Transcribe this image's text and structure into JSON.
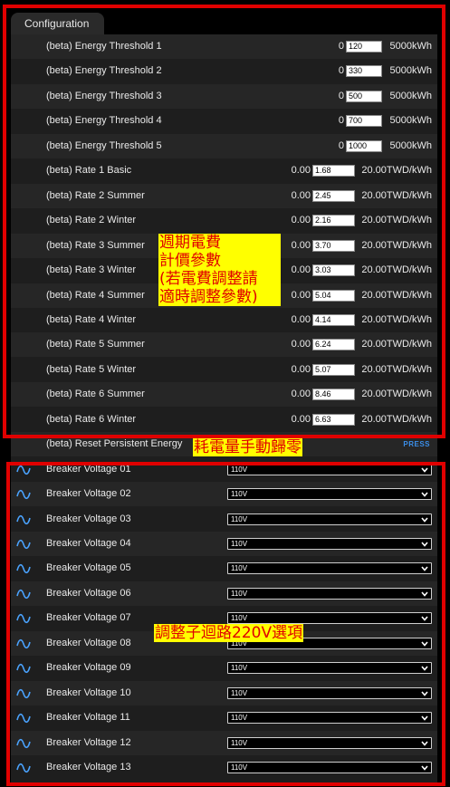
{
  "tab": {
    "label": "Configuration"
  },
  "thresholds": [
    {
      "label": "(beta) Energy Threshold 1",
      "min": "0",
      "value": "120",
      "max": "5000kWh"
    },
    {
      "label": "(beta) Energy Threshold 2",
      "min": "0",
      "value": "330",
      "max": "5000kWh"
    },
    {
      "label": "(beta) Energy Threshold 3",
      "min": "0",
      "value": "500",
      "max": "5000kWh"
    },
    {
      "label": "(beta) Energy Threshold 4",
      "min": "0",
      "value": "700",
      "max": "5000kWh"
    },
    {
      "label": "(beta) Energy Threshold 5",
      "min": "0",
      "value": "1000",
      "max": "5000kWh"
    }
  ],
  "rates": [
    {
      "label": "(beta) Rate 1 Basic",
      "min": "0.00",
      "value": "1.68",
      "max": "20.00TWD/kWh"
    },
    {
      "label": "(beta) Rate 2 Summer",
      "min": "0.00",
      "value": "2.45",
      "max": "20.00TWD/kWh"
    },
    {
      "label": "(beta) Rate 2 Winter",
      "min": "0.00",
      "value": "2.16",
      "max": "20.00TWD/kWh"
    },
    {
      "label": "(beta) Rate 3 Summer",
      "min": "0.00",
      "value": "3.70",
      "max": "20.00TWD/kWh"
    },
    {
      "label": "(beta) Rate 3 Winter",
      "min": "0.00",
      "value": "3.03",
      "max": "20.00TWD/kWh"
    },
    {
      "label": "(beta) Rate 4 Summer",
      "min": "0.00",
      "value": "5.04",
      "max": "20.00TWD/kWh"
    },
    {
      "label": "(beta) Rate 4 Winter",
      "min": "0.00",
      "value": "4.14",
      "max": "20.00TWD/kWh"
    },
    {
      "label": "(beta) Rate 5 Summer",
      "min": "0.00",
      "value": "6.24",
      "max": "20.00TWD/kWh"
    },
    {
      "label": "(beta) Rate 5 Winter",
      "min": "0.00",
      "value": "5.07",
      "max": "20.00TWD/kWh"
    },
    {
      "label": "(beta) Rate 6 Summer",
      "min": "0.00",
      "value": "8.46",
      "max": "20.00TWD/kWh"
    },
    {
      "label": "(beta) Rate 6 Winter",
      "min": "0.00",
      "value": "6.63",
      "max": "20.00TWD/kWh"
    }
  ],
  "reset": {
    "label": "(beta) Reset Persistent Energy",
    "button": "PRESS"
  },
  "breakers": [
    {
      "label": "Breaker Voltage 01",
      "value": "110V",
      "icon": "sine-wave-icon"
    },
    {
      "label": "Breaker Voltage 02",
      "value": "110V",
      "icon": "sine-wave-icon"
    },
    {
      "label": "Breaker Voltage 03",
      "value": "110V",
      "icon": "sine-wave-icon"
    },
    {
      "label": "Breaker Voltage 04",
      "value": "110V",
      "icon": "sine-wave-icon"
    },
    {
      "label": "Breaker Voltage 05",
      "value": "110V",
      "icon": "sine-wave-icon"
    },
    {
      "label": "Breaker Voltage 06",
      "value": "110V",
      "icon": "sine-wave-icon"
    },
    {
      "label": "Breaker Voltage 07",
      "value": "110V",
      "icon": "sine-wave-icon"
    },
    {
      "label": "Breaker Voltage 08",
      "value": "110V",
      "icon": "sine-wave-icon"
    },
    {
      "label": "Breaker Voltage 09",
      "value": "110V",
      "icon": "sine-wave-icon"
    },
    {
      "label": "Breaker Voltage 10",
      "value": "110V",
      "icon": "sine-wave-icon"
    },
    {
      "label": "Breaker Voltage 11",
      "value": "110V",
      "icon": "sine-wave-icon"
    },
    {
      "label": "Breaker Voltage 12",
      "value": "110V",
      "icon": "sine-wave-icon"
    },
    {
      "label": "Breaker Voltage 13",
      "value": "110V",
      "icon": "sine-wave-icon"
    }
  ],
  "annotations": {
    "rates_note": [
      "週期電費",
      "計價參數",
      "(若電費調整請",
      "適時調整參數)"
    ],
    "reset_note": "耗電量手動歸零",
    "breaker_note": "調整子迴路220V選項"
  },
  "colors": {
    "annotation_border": "#e00000",
    "annotation_background": "#ffff00",
    "annotation_text": "#e00000",
    "press_button": "#3b8ee8",
    "panel_background": "#1e1e1e"
  }
}
